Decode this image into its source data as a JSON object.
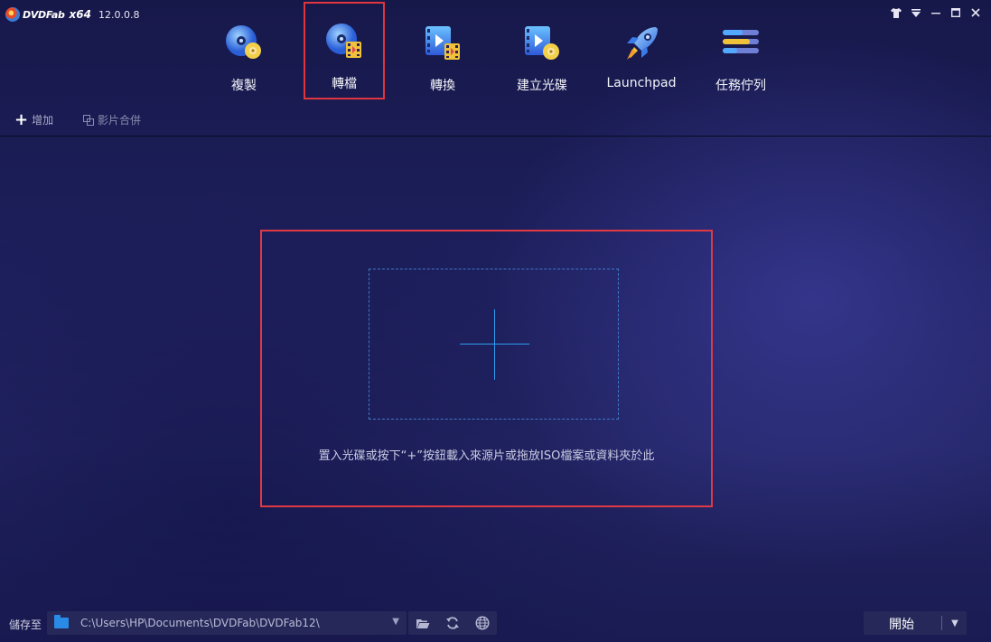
{
  "app": {
    "name": "DVDFab",
    "arch": "x64",
    "version": "12.0.0.8"
  },
  "window_controls": [
    {
      "name": "skin-icon",
      "glyph": "👕"
    },
    {
      "name": "menu-dropdown-icon",
      "glyph": "▼"
    },
    {
      "name": "minimize-icon",
      "glyph": "—"
    },
    {
      "name": "maximize-icon",
      "glyph": "▭"
    },
    {
      "name": "close-icon",
      "glyph": "✕"
    }
  ],
  "modules": [
    {
      "label": "複製",
      "icon": "disc-copy-icon",
      "active": false
    },
    {
      "label": "轉檔",
      "icon": "disc-ripper-icon",
      "active": true
    },
    {
      "label": "轉換",
      "icon": "video-converter-icon",
      "active": false
    },
    {
      "label": "建立光碟",
      "icon": "disc-creator-icon",
      "active": false
    },
    {
      "label": "Launchpad",
      "icon": "rocket-icon",
      "active": false
    },
    {
      "label": "任務佇列",
      "icon": "task-queue-icon",
      "active": false
    }
  ],
  "toolbar": {
    "add_label": "增加",
    "merge_label": "影片合併"
  },
  "drop_area": {
    "hint": "置入光碟或按下“+”按鈕載入來源片或拖放ISO檔案或資料夾於此"
  },
  "bottom": {
    "save_to_label": "儲存至",
    "path": "C:\\Users\\HP\\Documents\\DVDFab\\DVDFab12\\",
    "start_label": "開始"
  },
  "colors": {
    "accent_blue": "#2e9cf0",
    "highlight_red": "#e0353d"
  }
}
